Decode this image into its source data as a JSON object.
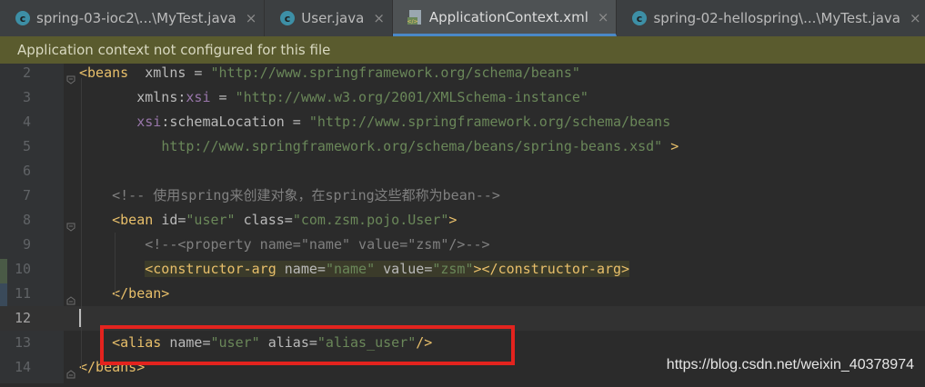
{
  "tabs": [
    {
      "label": "spring-03-ioc2\\...\\MyTest.java",
      "icon": "java-class-icon",
      "active": false
    },
    {
      "label": "User.java",
      "icon": "java-class-icon",
      "active": false
    },
    {
      "label": "ApplicationContext.xml",
      "icon": "xml-file-icon",
      "active": true
    },
    {
      "label": "spring-02-hellospring\\...\\MyTest.java",
      "icon": "java-class-icon",
      "active": false
    }
  ],
  "close_glyph": "×",
  "banner": {
    "text": "Application context not configured for this file"
  },
  "lines": [
    {
      "num": "2",
      "parts": [
        [
          "tag",
          "<beans"
        ],
        [
          "punct",
          "  "
        ],
        [
          "attr",
          "xmlns"
        ],
        [
          "punct",
          " = "
        ],
        [
          "val",
          "\"http://www.springframework.org/schema/beans\""
        ]
      ]
    },
    {
      "num": "3",
      "parts": [
        [
          "punct",
          "       "
        ],
        [
          "attr",
          "xmlns:"
        ],
        [
          "ns",
          "xsi"
        ],
        [
          "punct",
          " = "
        ],
        [
          "val",
          "\"http://www.w3.org/2001/XMLSchema-instance\""
        ]
      ]
    },
    {
      "num": "4",
      "parts": [
        [
          "punct",
          "       "
        ],
        [
          "ns",
          "xsi"
        ],
        [
          "attr",
          ":schemaLocation"
        ],
        [
          "punct",
          " = "
        ],
        [
          "val",
          "\"http://www.springframework.org/schema/beans"
        ]
      ]
    },
    {
      "num": "5",
      "parts": [
        [
          "punct",
          "          "
        ],
        [
          "val",
          "http://www.springframework.org/schema/beans/spring-beans.xsd\""
        ],
        [
          "punct",
          " "
        ],
        [
          "tag",
          ">"
        ]
      ]
    },
    {
      "num": "6",
      "parts": []
    },
    {
      "num": "7",
      "parts": [
        [
          "punct",
          "    "
        ],
        [
          "cmt",
          "<!-- 使用spring来创建对象，在spring这些都称为bean-->"
        ]
      ]
    },
    {
      "num": "8",
      "parts": [
        [
          "punct",
          "    "
        ],
        [
          "tag",
          "<bean "
        ],
        [
          "attr",
          "id"
        ],
        [
          "punct",
          "="
        ],
        [
          "val",
          "\"user\""
        ],
        [
          "punct",
          " "
        ],
        [
          "attr",
          "class"
        ],
        [
          "punct",
          "="
        ],
        [
          "val",
          "\"com.zsm.pojo.User\""
        ],
        [
          "tag",
          ">"
        ]
      ]
    },
    {
      "num": "9",
      "parts": [
        [
          "punct",
          "        "
        ],
        [
          "cmt",
          "<!--<property name=\"name\" value=\"zsm\"/>-->"
        ]
      ]
    },
    {
      "num": "10",
      "parts": [
        [
          "punct",
          "        "
        ],
        [
          "tag",
          "<constructor-arg "
        ],
        [
          "attr",
          "name"
        ],
        [
          "punct",
          "="
        ],
        [
          "val",
          "\"name\""
        ],
        [
          "punct",
          " "
        ],
        [
          "attr",
          "value"
        ],
        [
          "punct",
          "="
        ],
        [
          "val",
          "\"zsm\""
        ],
        [
          "tag",
          "></constructor-arg>"
        ]
      ]
    },
    {
      "num": "11",
      "parts": [
        [
          "punct",
          "    "
        ],
        [
          "tag",
          "</bean>"
        ]
      ]
    },
    {
      "num": "12",
      "parts": []
    },
    {
      "num": "13",
      "parts": [
        [
          "punct",
          "    "
        ],
        [
          "tag",
          "<alias "
        ],
        [
          "attr",
          "name"
        ],
        [
          "punct",
          "="
        ],
        [
          "val",
          "\"user\""
        ],
        [
          "punct",
          " "
        ],
        [
          "attr",
          "alias"
        ],
        [
          "punct",
          "="
        ],
        [
          "val",
          "\"alias_user\""
        ],
        [
          "tag",
          "/>"
        ]
      ]
    },
    {
      "num": "14",
      "parts": [
        [
          "tag",
          "</beans>"
        ]
      ]
    }
  ],
  "watermark": "https://blog.csdn.net/weixin_40378974",
  "colors": {
    "tag": "#e8bf6a",
    "value": "#6a8759",
    "comment": "#808080",
    "namespace": "#9876aa",
    "highlight_box": "#e3231e"
  }
}
